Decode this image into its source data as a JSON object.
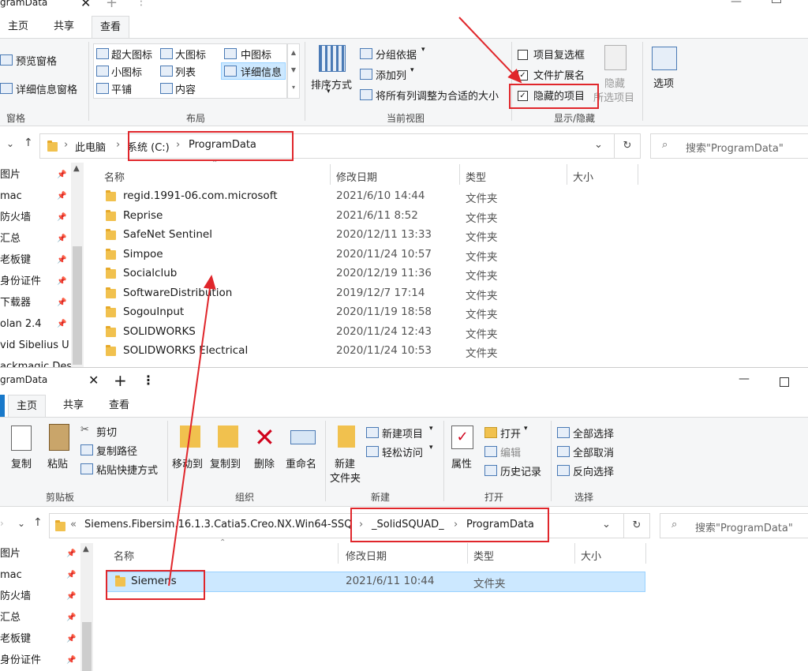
{
  "top": {
    "title": "gramData",
    "tabs": [
      "主页",
      "共享",
      "查看"
    ],
    "panes": {
      "preview": "预览窗格",
      "details": "详细信息窗格",
      "group": "窗格"
    },
    "layout": {
      "items": [
        "超大图标",
        "大图标",
        "中图标",
        "小图标",
        "列表",
        "详细信息",
        "平铺",
        "内容"
      ],
      "group": "布局"
    },
    "current_view": {
      "sort": "排序方式",
      "group_by": "分组依据",
      "add_col": "添加列",
      "fit_cols": "将所有列调整为合适的大小",
      "group": "当前视图"
    },
    "show_hide": {
      "item_checkboxes": "项目复选框",
      "file_ext": "文件扩展名",
      "hidden_items": "隐藏的项目",
      "hide": "隐藏",
      "selected": "所选项目",
      "options": "选项",
      "group": "显示/隐藏"
    },
    "address": [
      "此电脑",
      "系统 (C:)",
      "ProgramData"
    ],
    "search_placeholder": "搜索\"ProgramData\"",
    "columns": [
      "名称",
      "修改日期",
      "类型",
      "大小"
    ],
    "nav": [
      "图片",
      "mac",
      "防火墙",
      "汇总",
      "老板键",
      "身份证件",
      "下载器",
      "olan 2.4",
      "vid Sibelius U",
      "ackmagic Des"
    ],
    "files": [
      {
        "name": "regid.1991-06.com.microsoft",
        "date": "2021/6/10 14:44",
        "type": "文件夹"
      },
      {
        "name": "Reprise",
        "date": "2021/6/11 8:52",
        "type": "文件夹"
      },
      {
        "name": "SafeNet Sentinel",
        "date": "2020/12/11 13:33",
        "type": "文件夹"
      },
      {
        "name": "Simpoe",
        "date": "2020/11/24 10:57",
        "type": "文件夹"
      },
      {
        "name": "Socialclub",
        "date": "2020/12/19 11:36",
        "type": "文件夹"
      },
      {
        "name": "SoftwareDistribution",
        "date": "2019/12/7 17:14",
        "type": "文件夹"
      },
      {
        "name": "SogouInput",
        "date": "2020/11/19 18:58",
        "type": "文件夹"
      },
      {
        "name": "SOLIDWORKS",
        "date": "2020/11/24 12:43",
        "type": "文件夹"
      },
      {
        "name": "SOLIDWORKS Electrical",
        "date": "2020/11/24 10:53",
        "type": "文件夹"
      }
    ]
  },
  "bottom": {
    "title": "gramData",
    "tabs": [
      "主页",
      "共享",
      "查看"
    ],
    "clipboard": {
      "copy": "复制",
      "paste": "粘贴",
      "cut": "剪切",
      "copy_path": "复制路径",
      "paste_shortcut": "粘贴快捷方式",
      "group": "剪贴板"
    },
    "organize": {
      "move": "移动到",
      "copy_to": "复制到",
      "delete": "删除",
      "rename": "重命名",
      "group": "组织"
    },
    "new": {
      "new_item": "新建项目",
      "easy_access": "轻松访问",
      "new_folder_1": "新建",
      "new_folder_2": "文件夹",
      "group": "新建"
    },
    "open": {
      "props": "属性",
      "open": "打开",
      "edit": "编辑",
      "history": "历史记录",
      "group": "打开"
    },
    "select": {
      "all": "全部选择",
      "none": "全部取消",
      "invert": "反向选择",
      "group": "选择"
    },
    "address": [
      "Siemens.Fibersim.16.1.3.Catia5.Creo.NX.Win64-SSQ",
      "_SolidSQUAD_",
      "ProgramData"
    ],
    "search_placeholder": "搜索\"ProgramData\"",
    "columns": [
      "名称",
      "修改日期",
      "类型",
      "大小"
    ],
    "nav": [
      "图片",
      "mac",
      "防火墙",
      "汇总",
      "老板键",
      "身份证件"
    ],
    "files": [
      {
        "name": "Siemens",
        "date": "2021/6/11 10:44",
        "type": "文件夹"
      }
    ]
  }
}
